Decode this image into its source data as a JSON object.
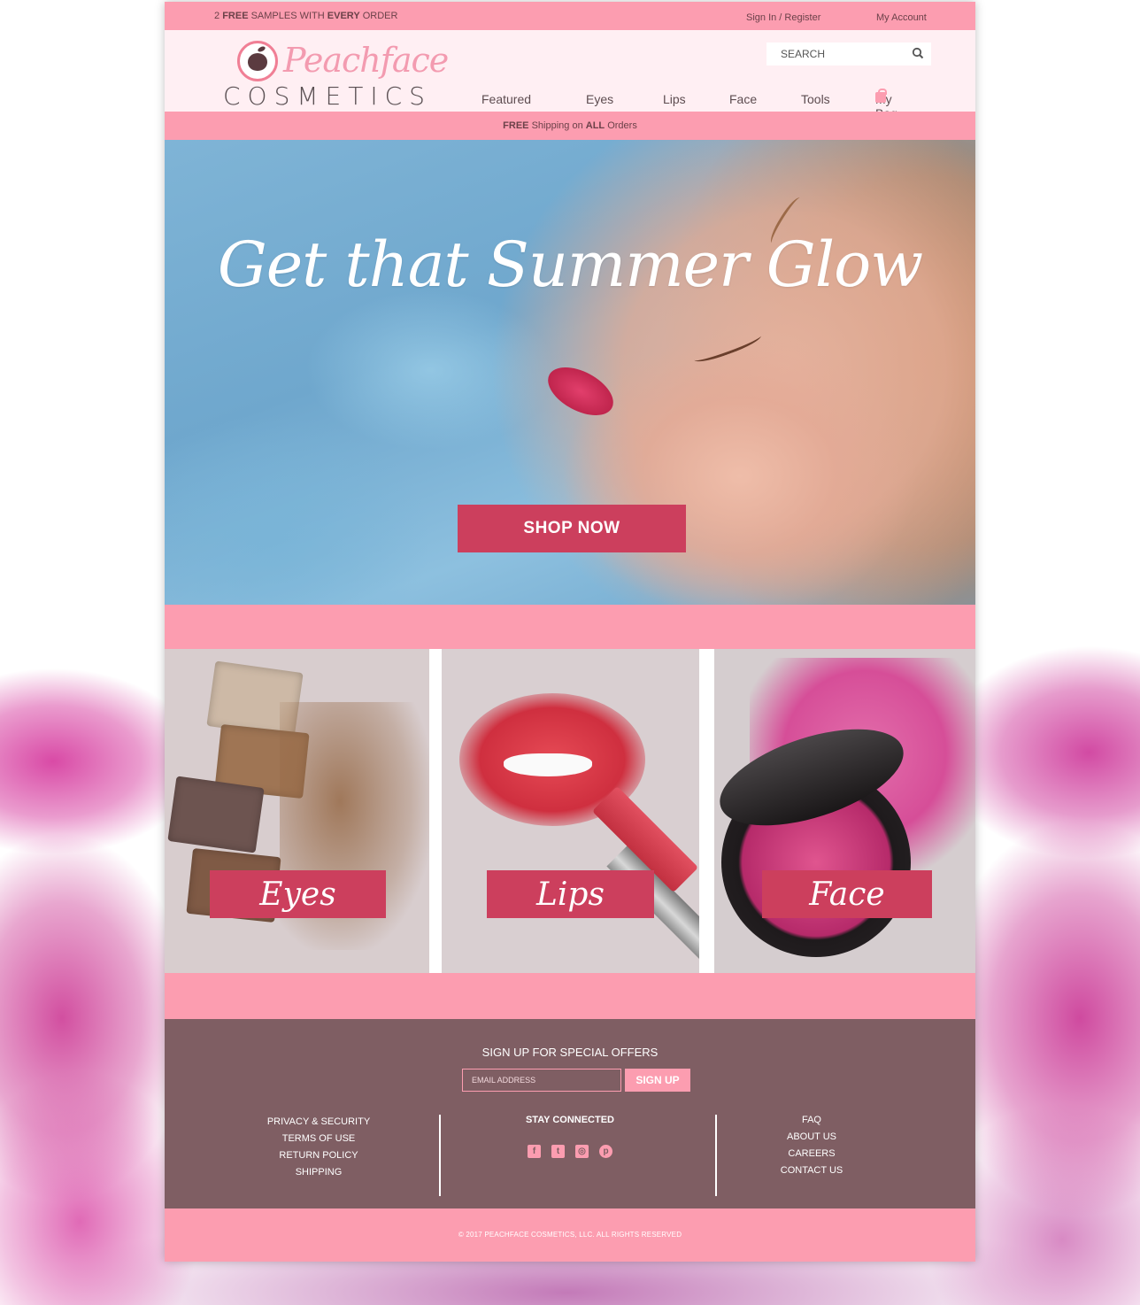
{
  "topbar": {
    "promo_count": "2",
    "promo_free": "FREE",
    "promo_mid": "SAMPLES WITH",
    "promo_every": "EVERY",
    "promo_end": "ORDER",
    "signin": "Sign In / Register",
    "account": "My Account"
  },
  "logo": {
    "script": "Peachface",
    "word": "COSMETICS"
  },
  "search": {
    "placeholder": "SEARCH"
  },
  "nav": {
    "items": [
      "Featured",
      "Eyes",
      "Lips",
      "Face",
      "Tools"
    ],
    "bag": "My Bag"
  },
  "shipping": {
    "free": "FREE",
    "mid": "Shipping on",
    "all": "ALL",
    "end": "Orders"
  },
  "hero": {
    "headline": "Get that Summer Glow",
    "cta": "SHOP NOW"
  },
  "categories": [
    {
      "label": "Eyes"
    },
    {
      "label": "Lips"
    },
    {
      "label": "Face"
    }
  ],
  "footer": {
    "signup_title": "SIGN UP FOR SPECIAL OFFERS",
    "email_placeholder": "EMAIL ADDRESS",
    "signup_button": "SIGN UP",
    "left_links": [
      "PRIVACY & SECURITY",
      "TERMS OF USE",
      "RETURN POLICY",
      "SHIPPING"
    ],
    "stay_connected": "STAY CONNECTED",
    "right_links": [
      "FAQ",
      "ABOUT US",
      "CAREERS",
      "CONTACT US"
    ],
    "copyright": "© 2017 PEACHFACE COSMETICS, LLC. ALL RIGHTS RESERVED"
  },
  "colors": {
    "pink": "#fc9db0",
    "accent": "#cc3f5d",
    "footer": "#7f5e63"
  },
  "icons": [
    "search-icon",
    "bag-icon",
    "facebook-icon",
    "twitter-icon",
    "instagram-icon",
    "pinterest-icon"
  ]
}
